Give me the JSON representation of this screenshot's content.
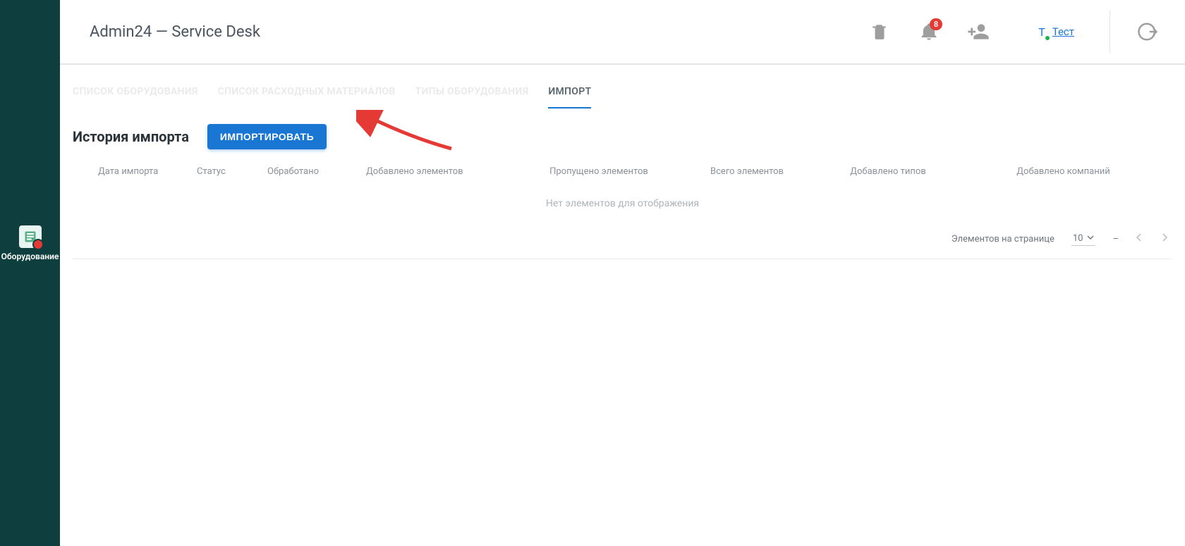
{
  "header": {
    "app_title": "Admin24 — Service Desk",
    "notification_count": "8",
    "user_initial": "Т",
    "user_name": "Тест"
  },
  "sidebar": {
    "equipment_label": "Оборудование"
  },
  "tabs": [
    {
      "label": "СПИСОК ОБОРУДОВАНИЯ",
      "active": false
    },
    {
      "label": "СПИСОК РАСХОДНЫХ МАТЕРИАЛОВ",
      "active": false
    },
    {
      "label": "ТИПЫ ОБОРУДОВАНИЯ",
      "active": false
    },
    {
      "label": "ИМПОРТ",
      "active": true
    }
  ],
  "page": {
    "subtitle": "История импорта",
    "import_button": "ИМПОРТИРОВАТЬ"
  },
  "table": {
    "headers": {
      "date": "Дата импорта",
      "status": "Статус",
      "processed": "Обработано",
      "added_items": "Добавлено элементов",
      "skipped_items": "Пропущено элементов",
      "total_items": "Всего элементов",
      "added_types": "Добавлено типов",
      "added_companies": "Добавлено компаний"
    },
    "empty_text": "Нет элементов для отображения"
  },
  "pagination": {
    "items_per_page_label": "Элементов на странице",
    "page_size": "10",
    "range": "–"
  }
}
